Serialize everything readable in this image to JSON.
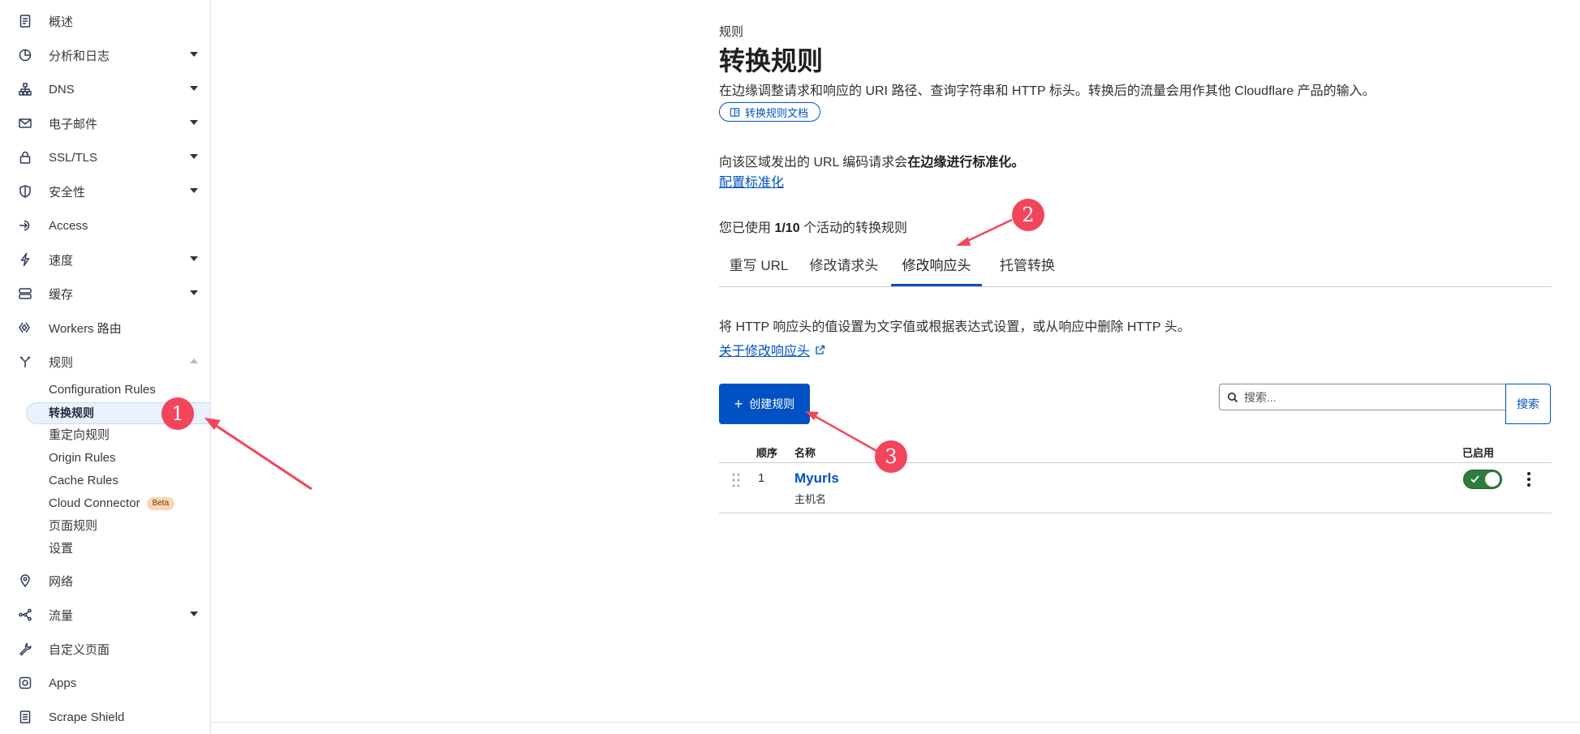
{
  "sidebar": {
    "items": [
      {
        "label": "概述",
        "icon": "document-icon",
        "caret": ""
      },
      {
        "label": "分析和日志",
        "icon": "pie-chart-icon",
        "caret": "down"
      },
      {
        "label": "DNS",
        "icon": "network-icon",
        "caret": "down"
      },
      {
        "label": "电子邮件",
        "icon": "mail-icon",
        "caret": "down"
      },
      {
        "label": "SSL/TLS",
        "icon": "lock-icon",
        "caret": "down"
      },
      {
        "label": "安全性",
        "icon": "shield-icon",
        "caret": "down"
      },
      {
        "label": "Access",
        "icon": "access-icon",
        "caret": ""
      },
      {
        "label": "速度",
        "icon": "lightning-icon",
        "caret": "down"
      },
      {
        "label": "缓存",
        "icon": "server-icon",
        "caret": "down"
      },
      {
        "label": "Workers 路由",
        "icon": "workers-icon",
        "caret": ""
      },
      {
        "label": "规则",
        "icon": "rules-icon",
        "caret": "up"
      },
      {
        "label": "网络",
        "icon": "location-icon",
        "caret": ""
      },
      {
        "label": "流量",
        "icon": "traffic-icon",
        "caret": "down"
      },
      {
        "label": "自定义页面",
        "icon": "wrench-icon",
        "caret": ""
      },
      {
        "label": "Apps",
        "icon": "apps-icon",
        "caret": ""
      },
      {
        "label": "Scrape Shield",
        "icon": "scrape-icon",
        "caret": ""
      }
    ],
    "sub_items": [
      {
        "label": "Configuration Rules"
      },
      {
        "label": "转换规则",
        "active": true
      },
      {
        "label": "重定向规则"
      },
      {
        "label": "Origin Rules"
      },
      {
        "label": "Cache Rules"
      },
      {
        "label": "Cloud Connector",
        "badge": "Beta"
      },
      {
        "label": "页面规则"
      },
      {
        "label": "设置"
      }
    ]
  },
  "header": {
    "breadcrumb": "规则",
    "title": "转换规则",
    "description": "在边缘调整请求和响应的 URI 路径、查询字符串和 HTTP 标头。转换后的流量会用作其他 Cloudflare 产品的输入。",
    "doc_button": "转换规则文档"
  },
  "normalization": {
    "text_prefix": "向该区域发出的 URL 编码请求会",
    "text_bold": "在边缘进行标准化。",
    "link": "配置标准化"
  },
  "usage": {
    "prefix": "您已使用 ",
    "count": "1/10",
    "suffix": " 个活动的转换规则"
  },
  "tabs": [
    {
      "label": "重写 URL"
    },
    {
      "label": "修改请求头"
    },
    {
      "label": "修改响应头",
      "active": true
    },
    {
      "label": "托管转换"
    }
  ],
  "section": {
    "description": "将 HTTP 响应头的值设置为文字值或根据表达式设置，或从响应中删除 HTTP 头。",
    "about_link": "关于修改响应头"
  },
  "actions": {
    "create_plus": "+",
    "create_label": "创建规则",
    "search_placeholder": "搜索...",
    "search_button": "搜索"
  },
  "table": {
    "headers": {
      "order": "顺序",
      "name": "名称",
      "enabled": "已启用"
    },
    "rows": [
      {
        "order": "1",
        "name": "Myurls",
        "subtitle": "主机名",
        "enabled": true
      }
    ]
  },
  "annotations": [
    "1",
    "2",
    "3"
  ],
  "colors": {
    "accent": "#0051c3",
    "toggle_on": "#2c7d3e",
    "marker": "#f2455b"
  }
}
